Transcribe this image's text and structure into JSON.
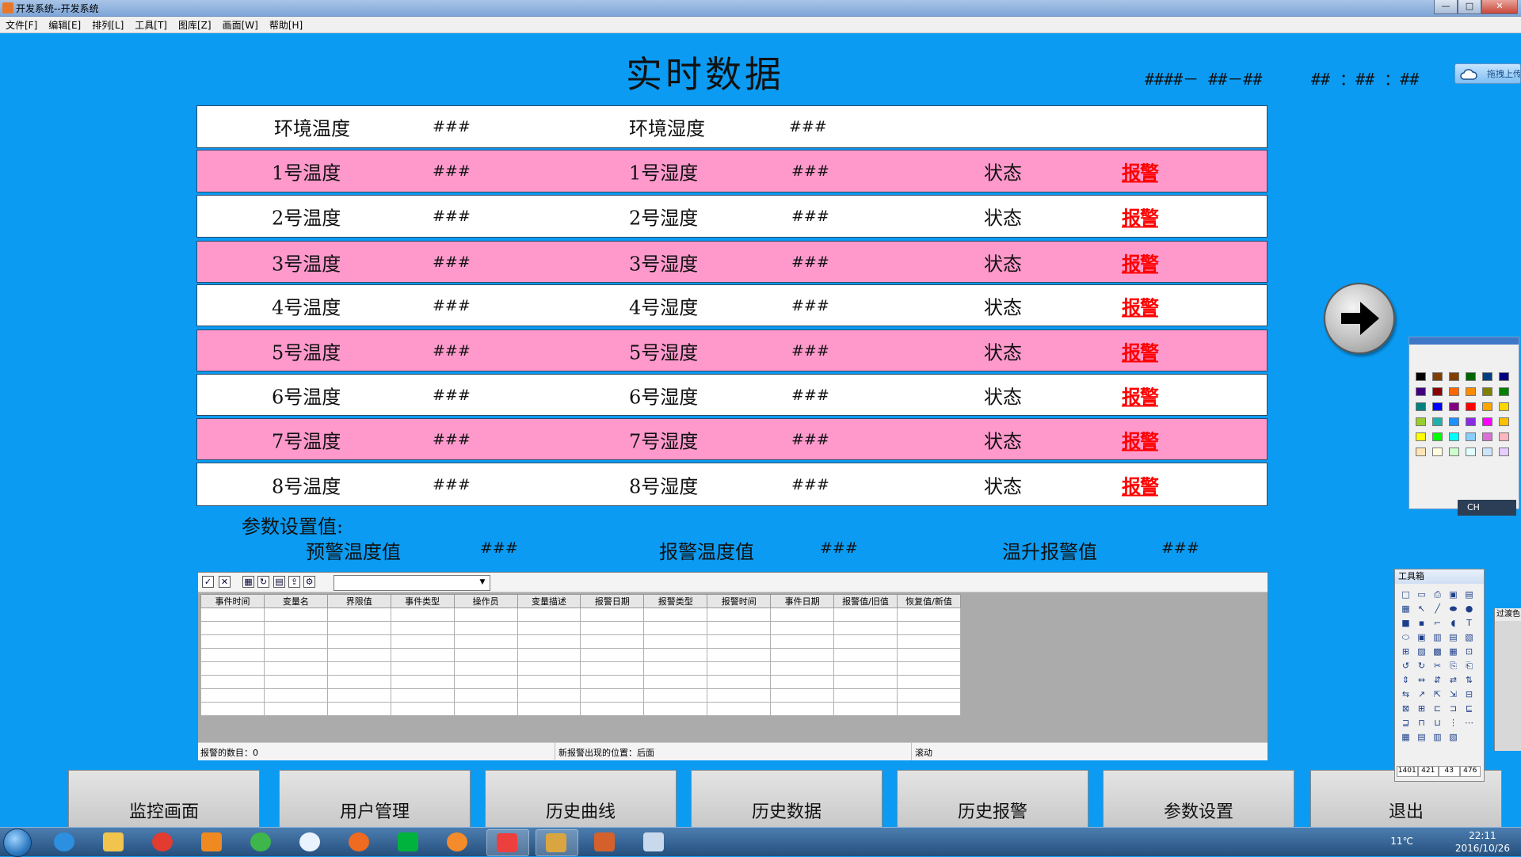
{
  "window": {
    "title": "开发系统--开发系统",
    "buttons": [
      "—",
      "□",
      "✕"
    ]
  },
  "menu": [
    "文件[F]",
    "编辑[E]",
    "排列[L]",
    "工具[T]",
    "图库[Z]",
    "画面[W]",
    "帮助[H]"
  ],
  "header": {
    "title": "实时数据",
    "date": "####－ ##－##",
    "time": "## ：## ：##",
    "upload_label": "拖拽上传"
  },
  "env_row": {
    "temp_label": "环境温度",
    "temp_value": "###",
    "hum_label": "环境湿度",
    "hum_value": "###"
  },
  "rows": [
    {
      "temp_label": "1号温度",
      "temp_value": "###",
      "hum_label": "1号湿度",
      "hum_value": "###",
      "status_label": "状态",
      "status_value": "报警"
    },
    {
      "temp_label": "2号温度",
      "temp_value": "###",
      "hum_label": "2号湿度",
      "hum_value": "###",
      "status_label": "状态",
      "status_value": "报警"
    },
    {
      "temp_label": "3号温度",
      "temp_value": "###",
      "hum_label": "3号湿度",
      "hum_value": "###",
      "status_label": "状态",
      "status_value": "报警"
    },
    {
      "temp_label": "4号温度",
      "temp_value": "###",
      "hum_label": "4号湿度",
      "hum_value": "###",
      "status_label": "状态",
      "status_value": "报警"
    },
    {
      "temp_label": "5号温度",
      "temp_value": "###",
      "hum_label": "5号湿度",
      "hum_value": "###",
      "status_label": "状态",
      "status_value": "报警"
    },
    {
      "temp_label": "6号温度",
      "temp_value": "###",
      "hum_label": "6号湿度",
      "hum_value": "###",
      "status_label": "状态",
      "status_value": "报警"
    },
    {
      "temp_label": "7号温度",
      "temp_value": "###",
      "hum_label": "7号湿度",
      "hum_value": "###",
      "status_label": "状态",
      "status_value": "报警"
    },
    {
      "temp_label": "8号温度",
      "temp_value": "###",
      "hum_label": "8号湿度",
      "hum_value": "###",
      "status_label": "状态",
      "status_value": "报警"
    }
  ],
  "params": {
    "title": "参数设置值:",
    "warn_temp_label": "预警温度值",
    "warn_temp_value": "###",
    "alarm_temp_label": "报警温度值",
    "alarm_temp_value": "###",
    "rise_alarm_label": "温升报警值",
    "rise_alarm_value": "###"
  },
  "alarm_table": {
    "columns": [
      "事件时间",
      "变量名",
      "界限值",
      "事件类型",
      "操作员",
      "变量描述",
      "报警日期",
      "报警类型",
      "报警时间",
      "事件日期",
      "报警值/旧值",
      "恢复值/新值"
    ],
    "empty_rows": 8,
    "status": {
      "count": "报警的数目：0",
      "position": "新报警出现的位置：后面",
      "scroll": "滚动"
    }
  },
  "nav": [
    "监控画面",
    "用户管理",
    "历史曲线",
    "历史数据",
    "历史报警",
    "参数设置",
    "退出"
  ],
  "toolbox": {
    "title": "工具箱",
    "footer": [
      "1401",
      "421",
      "43",
      "476"
    ],
    "side_title": "过渡色"
  },
  "palette_badge": "CH",
  "tray": {
    "weather": "11℃",
    "time": "22:11",
    "date": "2016/10/26"
  },
  "colors": {
    "background": "#0b9bf2",
    "row_pink": "#ff99cc",
    "row_white": "#ffffff",
    "alarm": "#ff0000"
  }
}
